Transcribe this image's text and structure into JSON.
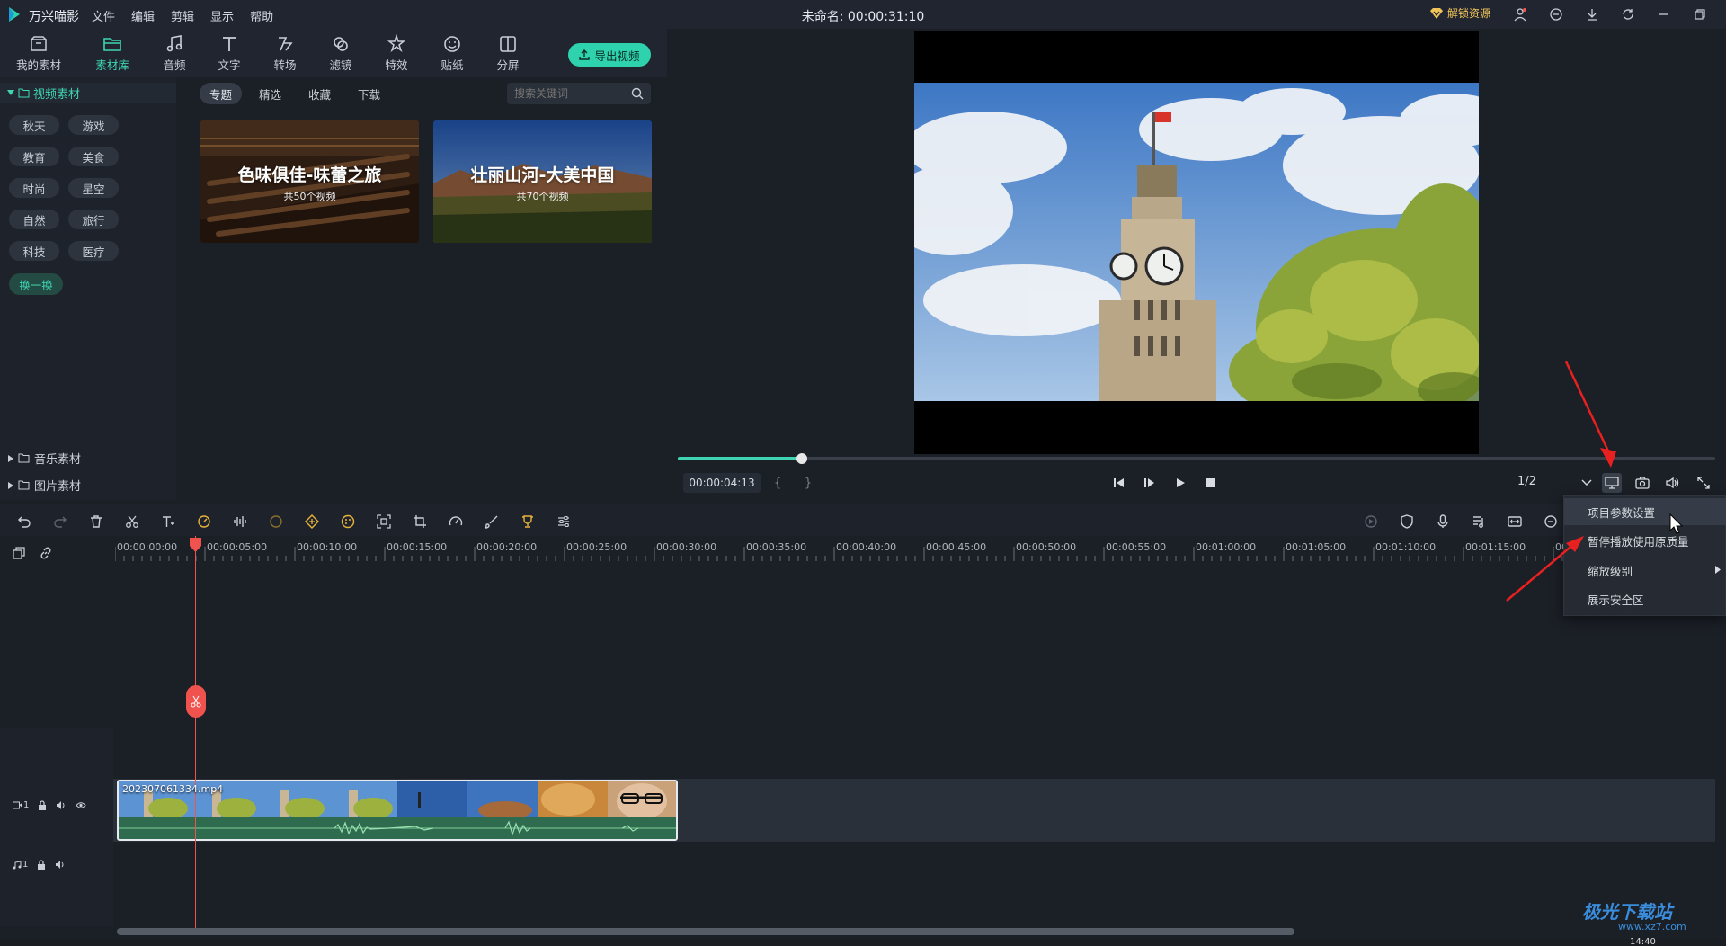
{
  "app": {
    "name": "万兴喵影",
    "document_title": "未命名: 00:00:31:10"
  },
  "menu": [
    "文件",
    "编辑",
    "剪辑",
    "显示",
    "帮助"
  ],
  "titlebar": {
    "unlock_label": "解锁资源"
  },
  "toolbar_top": {
    "tabs": [
      {
        "label": "我的素材",
        "icon": "folder-box-icon"
      },
      {
        "label": "素材库",
        "icon": "folder-icon",
        "active": true
      },
      {
        "label": "音频",
        "icon": "music-note-icon"
      },
      {
        "label": "文字",
        "icon": "text-icon"
      },
      {
        "label": "转场",
        "icon": "transition-icon"
      },
      {
        "label": "滤镜",
        "icon": "filter-icon"
      },
      {
        "label": "特效",
        "icon": "effects-icon"
      },
      {
        "label": "贴纸",
        "icon": "sticker-icon"
      },
      {
        "label": "分屏",
        "icon": "split-screen-icon"
      }
    ],
    "export_label": "导出视频"
  },
  "category_panel": {
    "header": "视频素材",
    "chips": [
      "秋天",
      "游戏",
      "教育",
      "美食",
      "时尚",
      "星空",
      "自然",
      "旅行",
      "科技",
      "医疗"
    ],
    "refresh_label": "换一换",
    "folds": [
      "音乐素材",
      "图片素材"
    ]
  },
  "browser": {
    "subtabs": [
      "专题",
      "精选",
      "收藏",
      "下载"
    ],
    "active_subtab": "专题",
    "search_placeholder": "搜索关键词",
    "cards": [
      {
        "title": "色味俱佳-味蕾之旅",
        "subtitle": "共50个视频"
      },
      {
        "title": "壮丽山河-大美中国",
        "subtitle": "共70个视频"
      }
    ]
  },
  "preview": {
    "timecode": "00:00:04:13",
    "in_mark": "{",
    "out_mark": "}",
    "progress": 0.12,
    "ratio": "1/2"
  },
  "timeline": {
    "ruler_labels": [
      "00:00:00:00",
      "00:00:05:00",
      "00:00:10:00",
      "00:00:15:00",
      "00:00:20:00",
      "00:00:25:00",
      "00:00:30:00",
      "00:00:35:00",
      "00:00:40:00",
      "00:00:45:00",
      "00:00:50:00",
      "00:00:55:00",
      "00:01:00:00",
      "00:01:05:00",
      "00:01:10:00",
      "00:01:15:00",
      "00"
    ],
    "clip_name": "202307061334.mp4",
    "video_track_label": "1",
    "audio_track_label": "1"
  },
  "dropdown": {
    "items": [
      "项目参数设置",
      "暂停播放使用原质量",
      "缩放级别",
      "展示安全区"
    ],
    "hovered": "项目参数设置"
  },
  "watermark": {
    "text": "极光下载站",
    "sub": "www.xz7.com"
  },
  "taskbar": {
    "clock": "14:40"
  },
  "colors": {
    "accent": "#3fd4b2",
    "playhead": "#f0534d",
    "annotation_arrow": "#e82020"
  }
}
